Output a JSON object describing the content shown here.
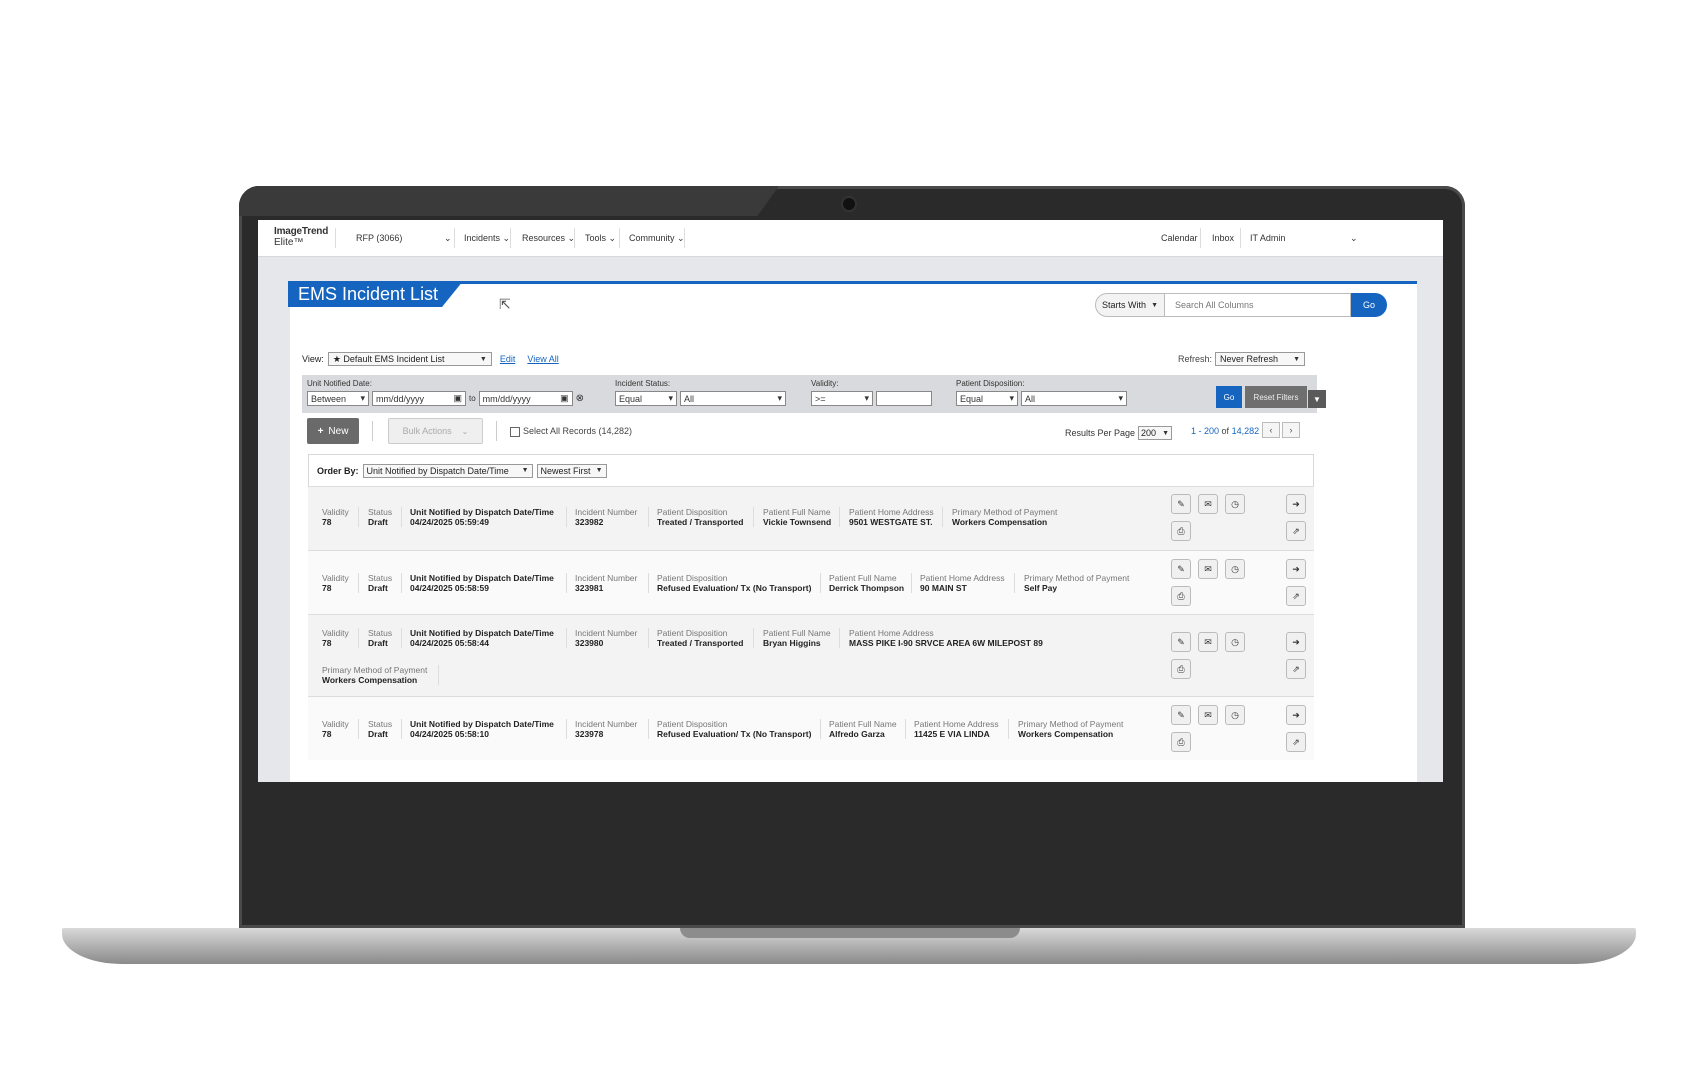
{
  "app": {
    "logo_line1": "ImageTrend",
    "logo_line2": "Elite™"
  },
  "topnav": {
    "agency": "RFP (3066)",
    "items": [
      "Incidents",
      "Resources",
      "Tools",
      "Community"
    ],
    "right": [
      "Calendar",
      "Inbox",
      "IT Admin"
    ]
  },
  "page": {
    "title": "EMS Incident List"
  },
  "search": {
    "mode": "Starts With",
    "placeholder": "Search All Columns",
    "go": "Go"
  },
  "view": {
    "label": "View:",
    "selected": "★ Default EMS Incident List",
    "edit": "Edit",
    "view_all": "View All"
  },
  "refresh": {
    "label": "Refresh:",
    "selected": "Never Refresh"
  },
  "filters": {
    "unit_notified": {
      "label": "Unit Notified Date:",
      "operator": "Between",
      "from": "mm/dd/yyyy",
      "to_label": "to",
      "to": "mm/dd/yyyy"
    },
    "incident_status": {
      "label": "Incident Status:",
      "operator": "Equal",
      "value": "All"
    },
    "validity": {
      "label": "Validity:",
      "operator": ">=",
      "value": ""
    },
    "patient_disposition": {
      "label": "Patient Disposition:",
      "operator": "Equal",
      "value": "All"
    },
    "go": "Go",
    "reset": "Reset Filters"
  },
  "actions": {
    "new": "New",
    "bulk": "Bulk Actions",
    "select_all": "Select All Records (14,282)",
    "results_label": "Results Per Page",
    "results_value": "200",
    "pager_range": "1 - 200",
    "pager_of": "of",
    "pager_total": "14,282"
  },
  "order": {
    "label": "Order By:",
    "field": "Unit Notified by Dispatch Date/Time",
    "direction": "Newest First"
  },
  "labels": {
    "validity": "Validity",
    "status": "Status",
    "unit_notified": "Unit Notified by Dispatch Date/Time",
    "incident_number": "Incident Number",
    "disposition": "Patient Disposition",
    "name": "Patient Full Name",
    "address": "Patient Home Address",
    "payment": "Primary Method of Payment"
  },
  "records": [
    {
      "validity": "78",
      "status": "Draft",
      "datetime": "04/24/2025 05:59:49",
      "incident": "323982",
      "disposition": "Treated / Transported",
      "name": "Vickie Townsend",
      "address": "9501 WESTGATE ST.",
      "payment": "Workers Compensation"
    },
    {
      "validity": "78",
      "status": "Draft",
      "datetime": "04/24/2025 05:58:59",
      "incident": "323981",
      "disposition": "Refused Evaluation/ Tx (No Transport)",
      "name": "Derrick Thompson",
      "address": "90 MAIN ST",
      "payment": "Self Pay"
    },
    {
      "validity": "78",
      "status": "Draft",
      "datetime": "04/24/2025 05:58:44",
      "incident": "323980",
      "disposition": "Treated / Transported",
      "name": "Bryan Higgins",
      "address": "MASS PIKE I-90 SRVCE AREA 6W MILEPOST 89",
      "payment": "Workers Compensation"
    },
    {
      "validity": "78",
      "status": "Draft",
      "datetime": "04/24/2025 05:58:10",
      "incident": "323978",
      "disposition": "Refused Evaluation/ Tx (No Transport)",
      "name": "Alfredo Garza",
      "address": "11425 E VIA LINDA",
      "payment": "Workers Compensation"
    }
  ],
  "colors": {
    "accent": "#1565c0",
    "panel": "#d8dadd"
  }
}
